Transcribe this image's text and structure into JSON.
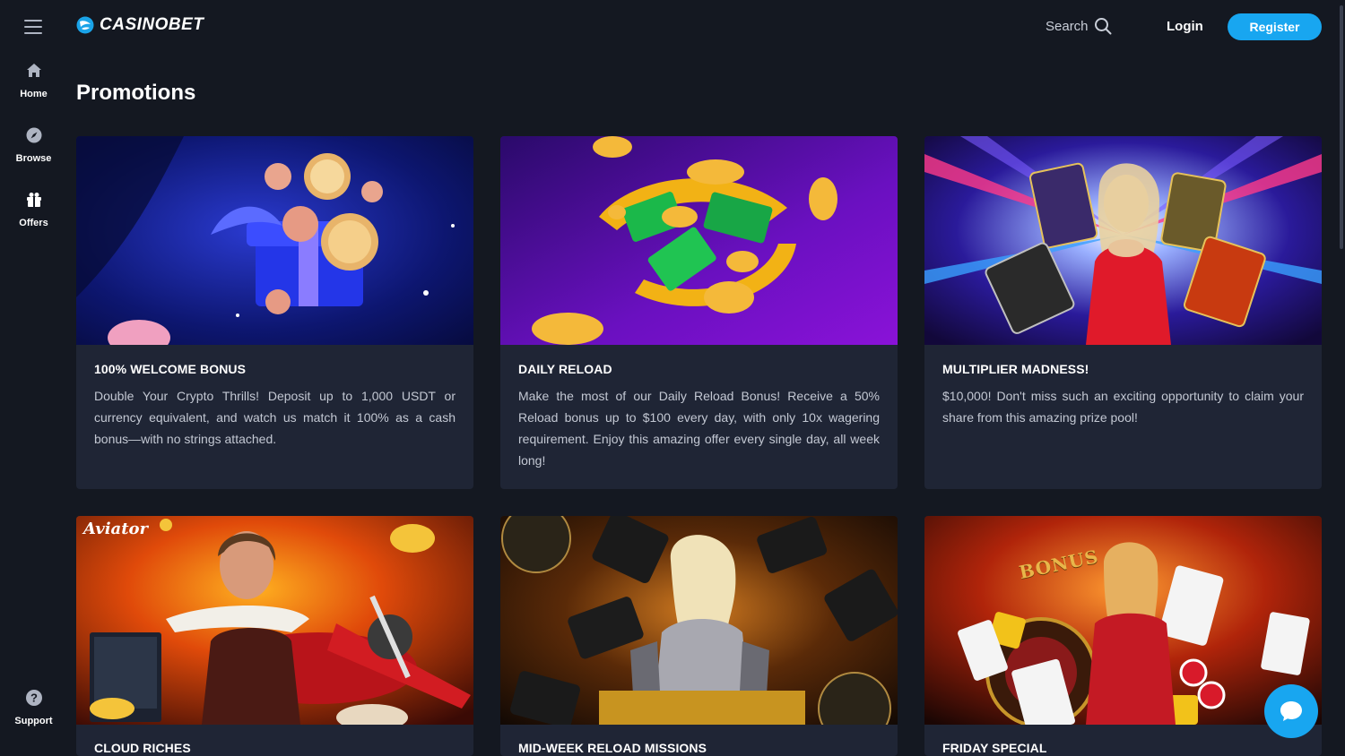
{
  "brand": {
    "name": "CASINOBET",
    "accent": "#18a6f0",
    "background": "#141821",
    "card_background": "#1f2535"
  },
  "sidebar": {
    "menu_icon": "hamburger-icon",
    "items": [
      {
        "label": "Home",
        "icon": "home-icon"
      },
      {
        "label": "Browse",
        "icon": "compass-icon"
      },
      {
        "label": "Offers",
        "icon": "gift-icon"
      }
    ],
    "support": {
      "label": "Support",
      "icon": "question-icon"
    }
  },
  "header": {
    "search_label": "Search",
    "login_label": "Login",
    "register_label": "Register"
  },
  "page": {
    "title": "Promotions"
  },
  "promotions": [
    {
      "title": "100% WELCOME BONUS",
      "description": "Double Your Crypto Thrills! Deposit up to 1,000 USDT or currency equivalent, and watch us match it 100% as a cash bonus—with no strings attached."
    },
    {
      "title": "DAILY RELOAD",
      "description": "Make the most of our Daily Reload Bonus! Receive a 50% Reload bonus up to $100 every day, with only 10x wagering requirement. Enjoy this amazing offer every single day, all week long!"
    },
    {
      "title": "MULTIPLIER MADNESS!",
      "description": "$10,000! Don't miss such an exciting opportunity to claim your share from this amazing prize pool!"
    },
    {
      "title": "CLOUD RICHES",
      "description": "",
      "banner_logo": "Aviator"
    },
    {
      "title": "MID-WEEK RELOAD MISSIONS",
      "description": ""
    },
    {
      "title": "FRIDAY SPECIAL",
      "description": "",
      "banner_text": "BONUS"
    }
  ],
  "chat": {
    "icon": "chat-icon"
  }
}
